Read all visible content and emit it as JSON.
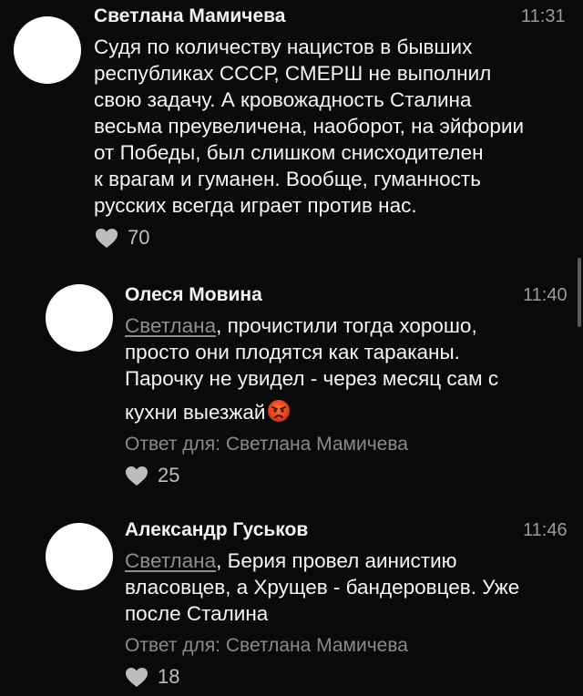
{
  "comments": [
    {
      "author": "Светлана Мамичева",
      "time": "11:31",
      "lines": [
        "Судя по количеству нацистов в бывших",
        "республиках СССР, СМЕРШ не выполнил",
        "свою задачу.  А кровожадность Сталина",
        "весьма преувеличена, наоборот, на эйфории",
        "от Победы, был слишком снисходителен",
        "к врагам и гуманен. Вообще, гуманность",
        "русских всегда играет против нас."
      ],
      "likes": "70"
    },
    {
      "author": "Олеся Мовина",
      "time": "11:40",
      "mention": "Светлана",
      "first_line_rest": ", прочистили тогда хорошо,",
      "lines": [
        "просто они плодятся как тараканы.",
        "Парочку не увидел - через месяц сам с",
        "кухни выезжай"
      ],
      "reply_to": "Ответ для: Светлана Мамичева",
      "likes": "25"
    },
    {
      "author": "Александр Гуськов",
      "time": "11:46",
      "mention": "Светлана",
      "first_line_rest": ", Берия провел аинистию",
      "lines": [
        "власовцев, а Хрущев - бандеровцев. Уже",
        "после Сталина"
      ],
      "reply_to": "Ответ для: Светлана Мамичева",
      "likes": "18"
    }
  ],
  "icons": {
    "like": "heart-icon",
    "emoji": "angry-face-icon"
  },
  "colors": {
    "background": "#0a0a0a",
    "text": "#f5f5f5",
    "muted": "#8a8a8a",
    "emoji": "#e8452c"
  }
}
